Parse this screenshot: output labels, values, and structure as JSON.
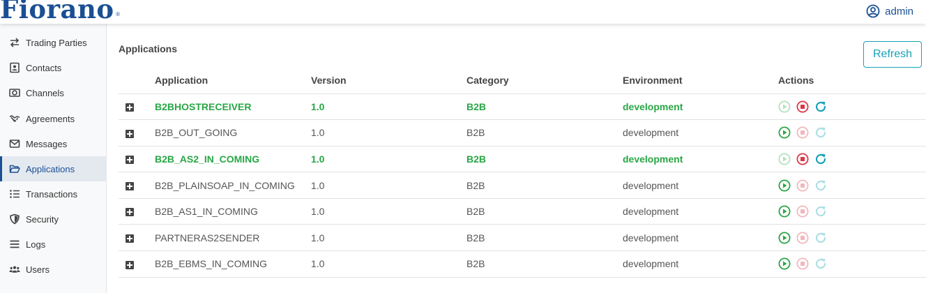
{
  "header": {
    "logo_text": "Fiorano",
    "logo_reg": "®",
    "user_label": "admin"
  },
  "sidebar": {
    "items": [
      {
        "label": "Trading Parties",
        "icon": "exchange-arrows-icon",
        "active": false
      },
      {
        "label": "Contacts",
        "icon": "contact-card-icon",
        "active": false
      },
      {
        "label": "Channels",
        "icon": "channels-icon",
        "active": false
      },
      {
        "label": "Agreements",
        "icon": "handshake-icon",
        "active": false
      },
      {
        "label": "Messages",
        "icon": "envelope-icon",
        "active": false
      },
      {
        "label": "Applications",
        "icon": "folder-open-icon",
        "active": true
      },
      {
        "label": "Transactions",
        "icon": "list-icon",
        "active": false
      },
      {
        "label": "Security",
        "icon": "shield-icon",
        "active": false
      },
      {
        "label": "Logs",
        "icon": "bars-icon",
        "active": false
      },
      {
        "label": "Users",
        "icon": "users-icon",
        "active": false
      }
    ]
  },
  "main": {
    "title": "Applications",
    "refresh_label": "Refresh",
    "columns": [
      "Application",
      "Version",
      "Category",
      "Environment",
      "Actions"
    ],
    "rows": [
      {
        "name": "B2BHOSTRECEIVER",
        "version": "1.0",
        "category": "B2B",
        "environment": "development",
        "running": true
      },
      {
        "name": "B2B_OUT_GOING",
        "version": "1.0",
        "category": "B2B",
        "environment": "development",
        "running": false
      },
      {
        "name": "B2B_AS2_IN_COMING",
        "version": "1.0",
        "category": "B2B",
        "environment": "development",
        "running": true
      },
      {
        "name": "B2B_PLAINSOAP_IN_COMING",
        "version": "1.0",
        "category": "B2B",
        "environment": "development",
        "running": false
      },
      {
        "name": "B2B_AS1_IN_COMING",
        "version": "1.0",
        "category": "B2B",
        "environment": "development",
        "running": false
      },
      {
        "name": "PARTNERAS2SENDER",
        "version": "1.0",
        "category": "B2B",
        "environment": "development",
        "running": false
      },
      {
        "name": "B2B_EBMS_IN_COMING",
        "version": "1.0",
        "category": "B2B",
        "environment": "development",
        "running": false
      }
    ]
  },
  "colors": {
    "brand": "#1b4f93",
    "running": "#28a745",
    "stop": "#dc3545",
    "refresh": "#17a2b8"
  }
}
